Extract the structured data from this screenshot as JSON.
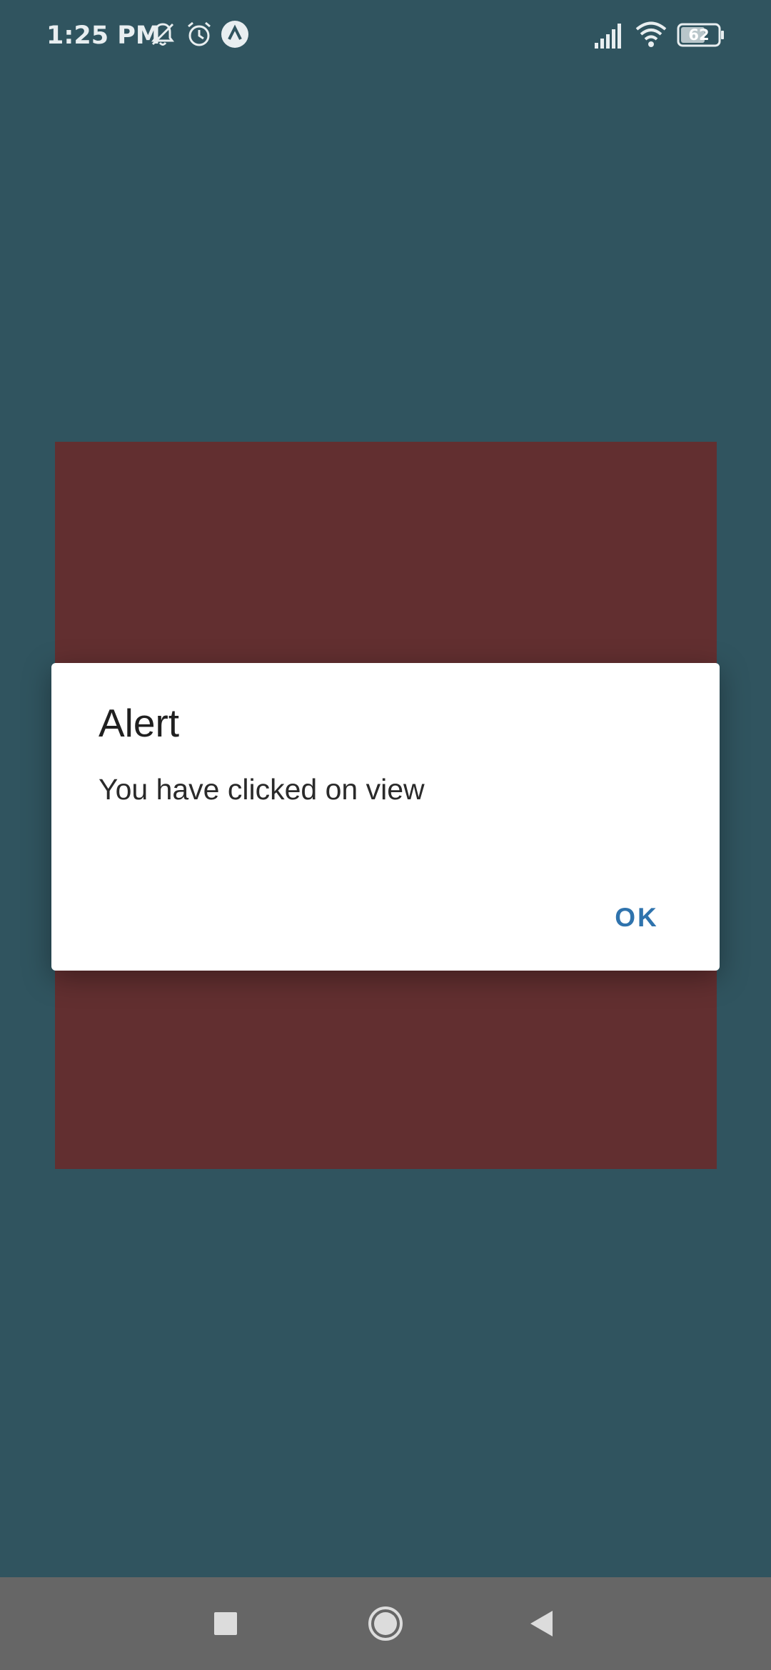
{
  "status_bar": {
    "time": "1:25 PM",
    "battery_level": "62",
    "icons": [
      "bell-muted-icon",
      "alarm-icon",
      "app-notification-icon",
      "signal-icon",
      "wifi-icon",
      "battery-icon"
    ]
  },
  "dialog": {
    "title": "Alert",
    "message": "You have clicked on view",
    "ok_label": "OK"
  },
  "nav_bar": {
    "icons": [
      "recents-icon",
      "home-icon",
      "back-icon"
    ]
  },
  "colors": {
    "background": "#30545f",
    "view": "#622f30",
    "dialog": "#ffffff",
    "button_text": "#2f73ad",
    "nav_bar": "#666666"
  }
}
